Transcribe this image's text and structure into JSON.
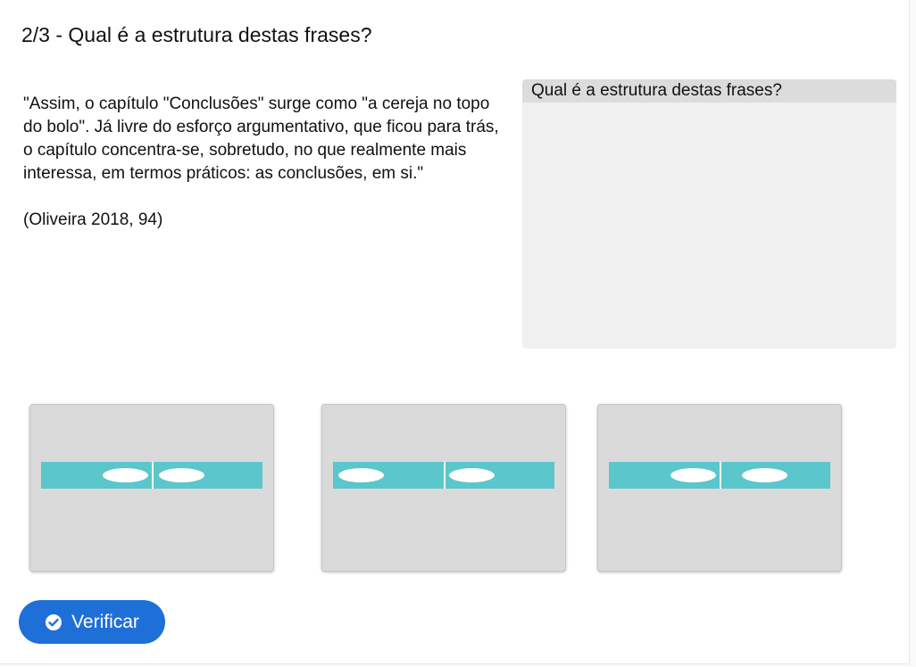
{
  "header": {
    "title": "2/3 - Qual é a estrutura destas frases?"
  },
  "quote": {
    "text": "\"Assim, o capítulo \"Conclusões\" surge como \"a cereja no topo do bolo\". Já livre do esforço argumentativo, que ficou para trás, o capítulo concentra-se, sobretudo, no que realmente mais interessa, em termos práticos: as conclusões, em si.\"",
    "citation": "(Oliveira 2018, 94)"
  },
  "dropzone": {
    "label": "Qual é a estrutura destas frases?"
  },
  "cards": [
    {
      "name": "option-card-1"
    },
    {
      "name": "option-card-2"
    },
    {
      "name": "option-card-3"
    }
  ],
  "verify_button": {
    "label": "Verificar",
    "icon": "check-circle-icon"
  },
  "colors": {
    "accent": "#1f6fd9",
    "bar": "#5bc6cc",
    "card": "#dadada",
    "dropzone": "#f0f0f0"
  }
}
